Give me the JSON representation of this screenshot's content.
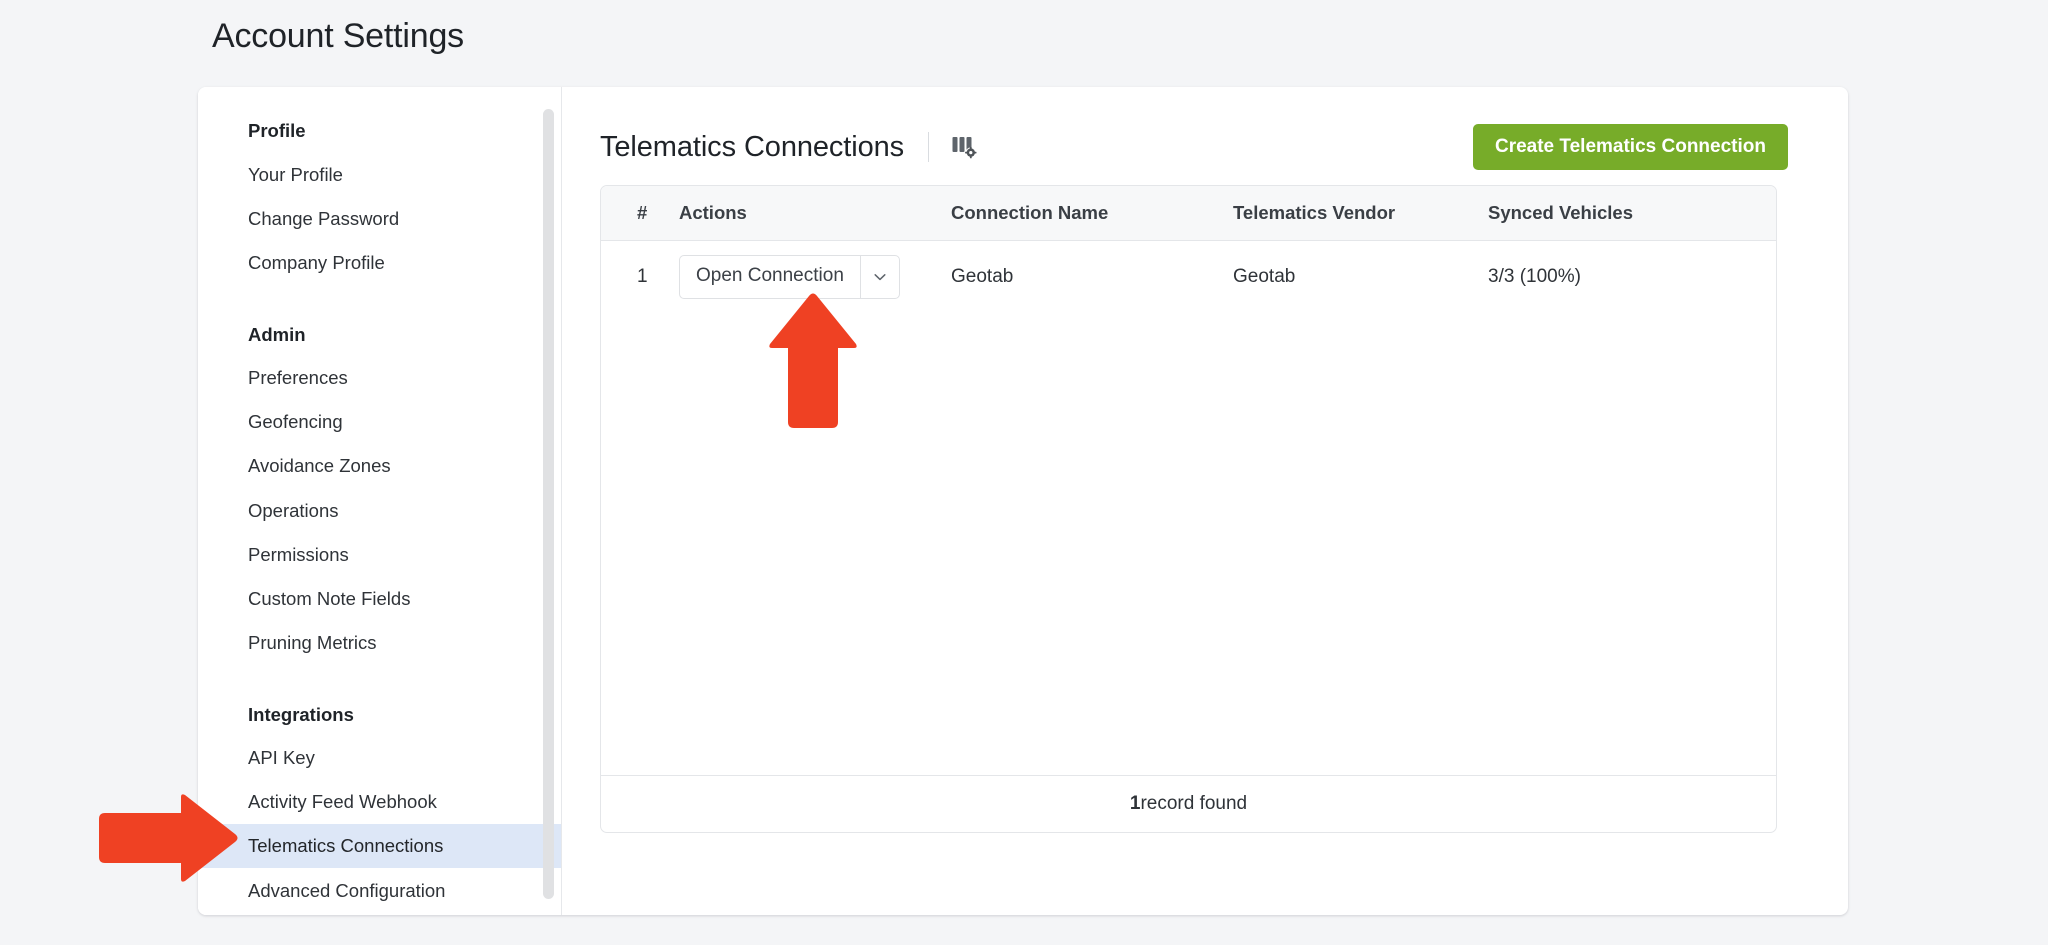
{
  "page": {
    "title": "Account Settings",
    "accent_green": "#77ac29",
    "highlight_blue": "#dde7f7",
    "annotation_red": "#ef4123"
  },
  "sidebar": {
    "groups": [
      {
        "heading": "Profile",
        "items": [
          {
            "label": "Your Profile",
            "active": false
          },
          {
            "label": "Change Password",
            "active": false
          },
          {
            "label": "Company Profile",
            "active": false
          }
        ]
      },
      {
        "heading": "Admin",
        "items": [
          {
            "label": "Preferences",
            "active": false
          },
          {
            "label": "Geofencing",
            "active": false
          },
          {
            "label": "Avoidance Zones",
            "active": false
          },
          {
            "label": "Operations",
            "active": false
          },
          {
            "label": "Permissions",
            "active": false
          },
          {
            "label": "Custom Note Fields",
            "active": false
          },
          {
            "label": "Pruning Metrics",
            "active": false
          }
        ]
      },
      {
        "heading": "Integrations",
        "items": [
          {
            "label": "API Key",
            "active": false
          },
          {
            "label": "Activity Feed Webhook",
            "active": false
          },
          {
            "label": "Telematics Connections",
            "active": true
          },
          {
            "label": "Advanced Configuration",
            "active": false
          }
        ]
      }
    ]
  },
  "main": {
    "title": "Telematics Connections",
    "column_settings_icon": "columns-gear-icon",
    "create_button": "Create Telematics Connection",
    "table": {
      "columns": [
        "#",
        "Actions",
        "Connection Name",
        "Telematics Vendor",
        "Synced Vehicles"
      ],
      "rows": [
        {
          "index": "1",
          "action_label": "Open Connection",
          "action_caret_icon": "chevron-down-icon",
          "connection_name": "Geotab",
          "telematics_vendor": "Geotab",
          "synced_vehicles": "3/3 (100%)"
        }
      ],
      "footer_count": "1",
      "footer_text": " record found"
    }
  },
  "annotations": [
    {
      "name": "arrow-pointing-telematics-connections",
      "direction": "right"
    },
    {
      "name": "arrow-pointing-open-connection",
      "direction": "up"
    }
  ]
}
